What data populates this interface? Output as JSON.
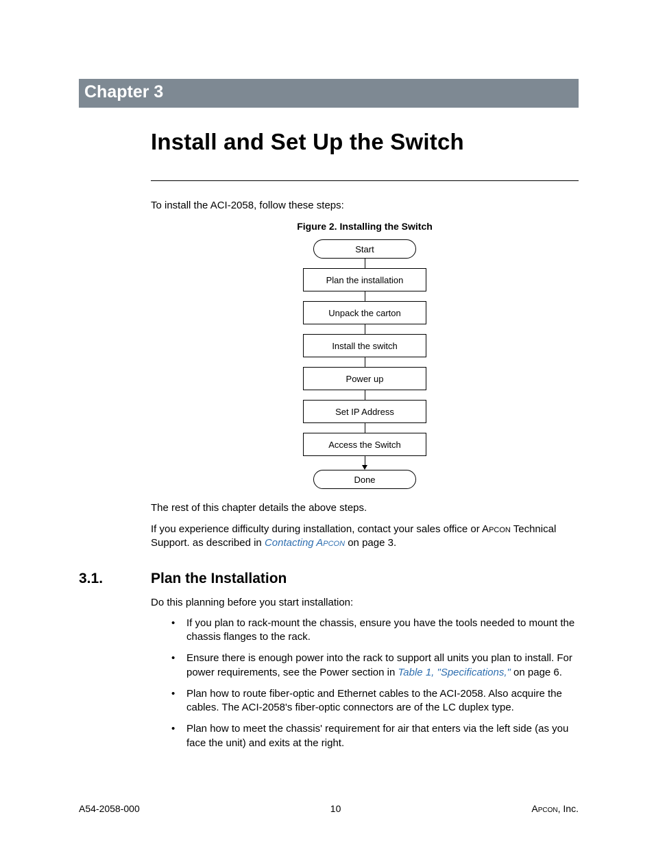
{
  "chapter": {
    "label": "Chapter 3",
    "title": "Install and Set Up the Switch"
  },
  "intro": "To install the ACI-2058, follow these steps:",
  "figure": {
    "caption": "Figure 2. Installing the Switch",
    "start": "Start",
    "steps": [
      "Plan the installation",
      "Unpack the carton",
      "Install the switch",
      "Power up",
      "Set IP Address",
      "Access the Switch"
    ],
    "end": "Done"
  },
  "after_fig_1": "The rest of this chapter details the above steps.",
  "after_fig_2a": "If you experience difficulty during installation, contact your sales office or A",
  "after_fig_2b": "pcon",
  "after_fig_2c": " Technical Support. as described in ",
  "link1a": "Contacting A",
  "link1b": "pcon",
  "after_fig_2d": " on page 3.",
  "section": {
    "num": "3.1.",
    "title": "Plan the Installation"
  },
  "plan_intro": "Do this planning before you start installation:",
  "bullets": [
    {
      "text": "If you plan to rack-mount the chassis, ensure you have the tools needed to mount the chassis flanges to the rack."
    },
    {
      "pre": "Ensure there is enough power into the rack to support all units you plan to install. For power requirements, see the Power section in ",
      "link": "Table 1, \"Specifications,\"",
      "post": " on page 6."
    },
    {
      "text": "Plan how to route fiber-optic and Ethernet cables to the ACI-2058. Also acquire the cables. The ACI-2058's fiber-optic connectors are of the LC duplex type."
    },
    {
      "text": "Plan how to meet the chassis' requirement for air that enters via the left side (as you face the unit) and exits at the right."
    }
  ],
  "footer": {
    "left": "A54-2058-000",
    "center": "10",
    "right_a": "A",
    "right_b": "pcon",
    "right_c": ", Inc."
  }
}
